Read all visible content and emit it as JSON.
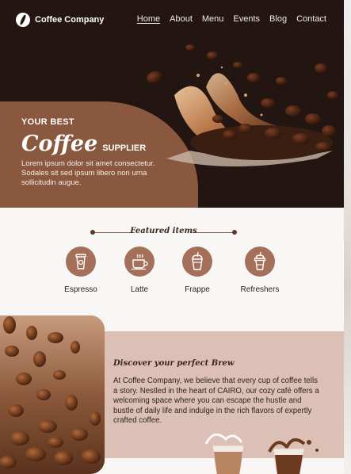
{
  "brand": {
    "name": "Coffee Company"
  },
  "nav": {
    "items": [
      {
        "label": "Home",
        "active": true
      },
      {
        "label": "About"
      },
      {
        "label": "Menu"
      },
      {
        "label": "Events"
      },
      {
        "label": "Blog"
      },
      {
        "label": "Contact"
      }
    ]
  },
  "hero": {
    "eyebrow": "YOUR BEST",
    "script_word": "Coffee",
    "word_after": "SUPPLIER",
    "description": "Lorem ipsum dolor sit amet consectetur. Sodales sit sed ipsum libero non urna sollicitudin augue."
  },
  "featured": {
    "heading": "Featured items",
    "items": [
      {
        "label": "Espresso",
        "icon": "espresso-cup-icon"
      },
      {
        "label": "Latte",
        "icon": "latte-mug-icon"
      },
      {
        "label": "Frappe",
        "icon": "frappe-cup-icon"
      },
      {
        "label": "Refreshers",
        "icon": "refresher-cup-icon"
      }
    ]
  },
  "discover": {
    "title": "Discover your perfect Brew",
    "body": "At Coffee Company, we believe that every cup of coffee tells a story. Nestled in the heart of CAIRO, our cozy café offers a welcoming space where you can escape the hustle and bustle of daily life and indulge in the rich flavors of expertly crafted coffee."
  },
  "colors": {
    "hero_bg": "#231511",
    "accent_brown": "#8a573f",
    "icon_circle": "#a5705a",
    "discover_bg": "#dcc0b5"
  }
}
